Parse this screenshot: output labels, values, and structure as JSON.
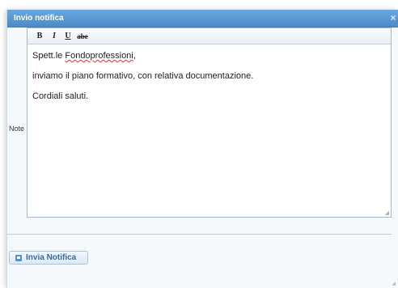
{
  "dialog": {
    "title": "Invio notifica",
    "close_icon": "×"
  },
  "form": {
    "note_label": "Note"
  },
  "toolbar": {
    "bold": "B",
    "italic": "I",
    "underline": "U",
    "strikethrough": "abe"
  },
  "editor": {
    "line1_prefix": "Spett.le ",
    "line1_name": "Fondoprofessioni",
    "line1_suffix": ",",
    "line2": "inviamo il piano formativo, con relativa documentazione.",
    "line3": "Cordiali saluti."
  },
  "actions": {
    "send_label": "Invia Notifica"
  },
  "colors": {
    "titlebar": "#4a8cc9",
    "accent": "#3a6a9a"
  }
}
